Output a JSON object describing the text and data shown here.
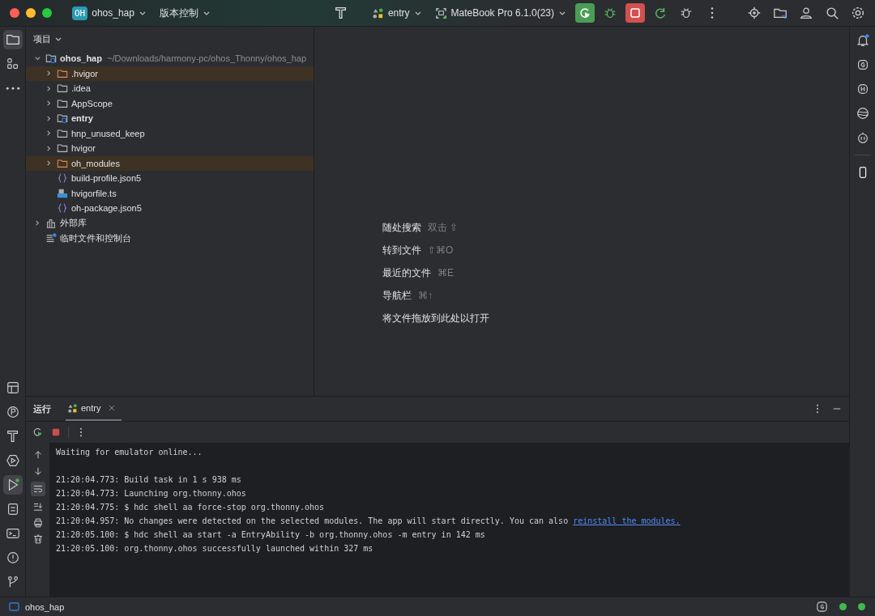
{
  "title_bar": {
    "project_badge": "OH",
    "project": "ohos_hap",
    "vcs": "版本控制",
    "run_config": "entry",
    "device": "MateBook Pro 6.1.0(23)"
  },
  "left_toolbar": {
    "top": [
      {
        "kind": "folder",
        "selected": true
      },
      {
        "kind": "structure",
        "selected": false
      },
      {
        "kind": "more",
        "selected": false
      }
    ],
    "bottom": [
      {
        "kind": "layout",
        "selected": false
      },
      {
        "kind": "profiler",
        "selected": false
      },
      {
        "kind": "build",
        "selected": false
      },
      {
        "kind": "services",
        "selected": false
      },
      {
        "kind": "run",
        "selected": true
      },
      {
        "kind": "todo",
        "selected": false
      },
      {
        "kind": "terminal",
        "selected": false
      },
      {
        "kind": "problems",
        "selected": false
      },
      {
        "kind": "git",
        "selected": false
      }
    ]
  },
  "project_panel": {
    "title": "项目",
    "tree": [
      {
        "kind": "module",
        "label": "ohos_hap",
        "hint": "~/Downloads/harmony-pc/ohos_Thonny/ohos_hap",
        "expanded": true,
        "excluded": false,
        "children": [
          {
            "kind": "folder",
            "label": ".hvigor",
            "expanded": false,
            "excluded": true
          },
          {
            "kind": "folder",
            "label": ".idea",
            "expanded": false,
            "excluded": false
          },
          {
            "kind": "folder",
            "label": "AppScope",
            "expanded": false,
            "excluded": false
          },
          {
            "kind": "module",
            "label": "entry",
            "expanded": false,
            "excluded": false
          },
          {
            "kind": "folder",
            "label": "hnp_unused_keep",
            "expanded": false,
            "excluded": false
          },
          {
            "kind": "folder",
            "label": "hvigor",
            "expanded": false,
            "excluded": false
          },
          {
            "kind": "folder",
            "label": "oh_modules",
            "expanded": false,
            "excluded": true
          },
          {
            "kind": "json",
            "label": "build-profile.json5",
            "excluded": false
          },
          {
            "kind": "ts",
            "label": "hvigorfile.ts",
            "excluded": false
          },
          {
            "kind": "json",
            "label": "oh-package.json5",
            "excluded": false
          }
        ]
      },
      {
        "kind": "library",
        "label": "外部库",
        "expanded": false,
        "excluded": false
      },
      {
        "kind": "scratch",
        "label": "临时文件和控制台",
        "excluded": false
      }
    ]
  },
  "editor_hints": [
    {
      "label": "随处搜索",
      "shortcut": "双击 ⇧"
    },
    {
      "label": "转到文件",
      "shortcut": "⇧⌘O"
    },
    {
      "label": "最近的文件",
      "shortcut": "⌘E"
    },
    {
      "label": "导航栏",
      "shortcut": "⌘↑"
    },
    {
      "label": "将文件拖放到此处以打开"
    }
  ],
  "run_panel": {
    "title": "运行",
    "tabs": [
      {
        "label": "entry",
        "selected": true
      }
    ],
    "console_blocks": [
      {
        "lines": [
          {
            "text": "Waiting for emulator online..."
          }
        ]
      },
      {
        "lines": [
          {
            "text": "21:20:04.773: Build task in 1 s 938 ms"
          },
          {
            "text": "21:20:04.773: Launching org.thonny.ohos"
          },
          {
            "text": "21:20:04.775: $ hdc shell aa force-stop org.thonny.ohos"
          },
          {
            "text": "21:20:04.957: No changes were detected on the selected modules. The app will start directly. You can also ",
            "link": "reinstall the modules."
          },
          {
            "text": "21:20:05.100: $ hdc shell aa start -a EntryAbility -b org.thonny.ohos -m entry in 142 ms"
          },
          {
            "text": "21:20:05.100: org.thonny.ohos successfully launched within 327 ms"
          }
        ]
      }
    ]
  },
  "status_bar": {
    "project": "ohos_hap"
  }
}
